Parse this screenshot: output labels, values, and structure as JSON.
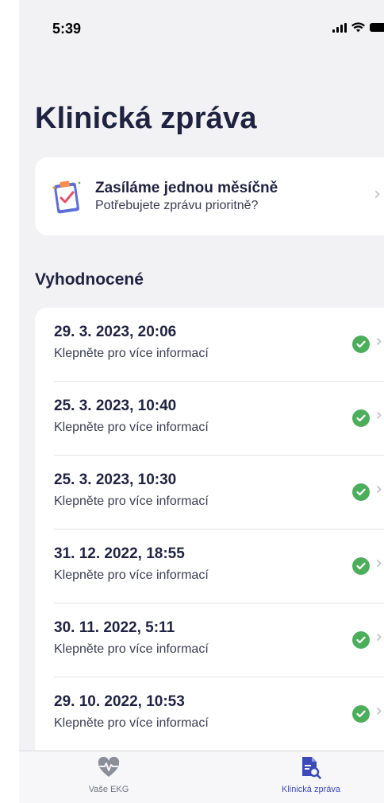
{
  "status_bar": {
    "time": "5:39"
  },
  "page": {
    "title": "Klinická zpráva"
  },
  "banner": {
    "title": "Zasíláme jednou měsíčně",
    "subtitle": "Potřebujete zprávu prioritně?"
  },
  "section": {
    "title": "Vyhodnocené"
  },
  "reports": [
    {
      "date": "29. 3. 2023, 20:06",
      "subtitle": "Klepněte pro více informací",
      "status": "evaluated"
    },
    {
      "date": "25. 3. 2023, 10:40",
      "subtitle": "Klepněte pro více informací",
      "status": "evaluated"
    },
    {
      "date": "25. 3. 2023, 10:30",
      "subtitle": "Klepněte pro více informací",
      "status": "evaluated"
    },
    {
      "date": "31. 12. 2022, 18:55",
      "subtitle": "Klepněte pro více informací",
      "status": "evaluated"
    },
    {
      "date": "30. 11. 2022, 5:11",
      "subtitle": "Klepněte pro více informací",
      "status": "evaluated"
    },
    {
      "date": "29. 10. 2022, 10:53",
      "subtitle": "Klepněte pro více informací",
      "status": "evaluated"
    }
  ],
  "tab_bar": {
    "tabs": [
      {
        "label": "Vaše EKG",
        "icon": "heart-pulse-icon",
        "active": false
      },
      {
        "label": "Klinická zpráva",
        "icon": "document-search-icon",
        "active": true
      }
    ]
  },
  "colors": {
    "accent": "#3c4ab8",
    "status_ok": "#4cae5a",
    "background": "#f2f2f4"
  }
}
